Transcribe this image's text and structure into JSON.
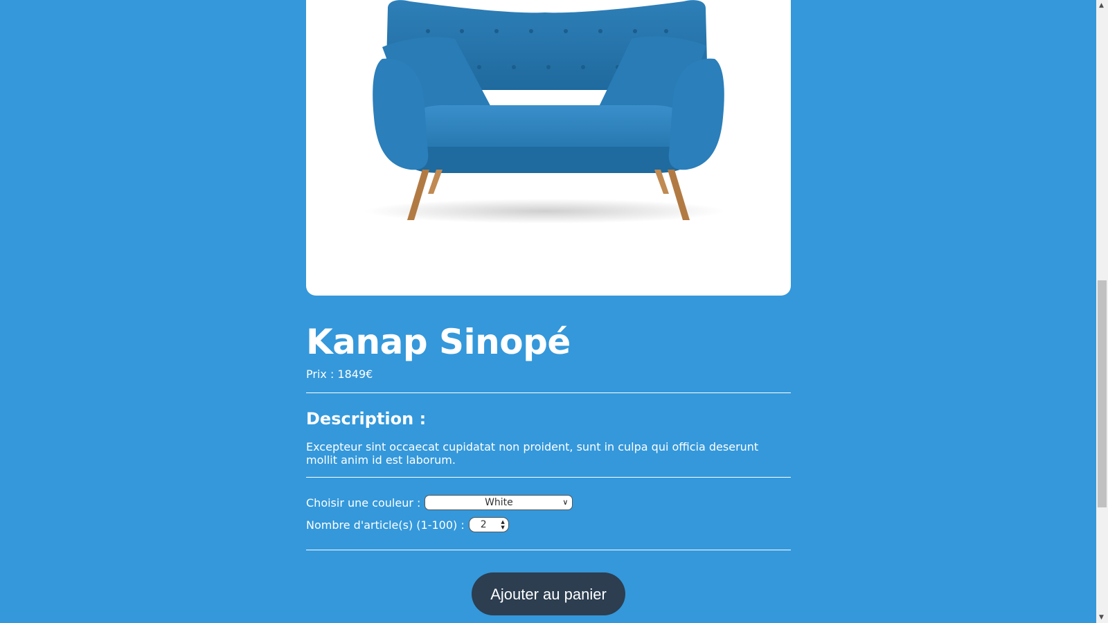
{
  "product": {
    "image_alt": "Kanap Sinopé",
    "name": "Kanap Sinopé",
    "price_label": "Prix : 1849€"
  },
  "description": {
    "title": "Description :",
    "text": "Excepteur sint occaecat cupidatat non proident, sunt in culpa qui officia deserunt mollit anim id est laborum."
  },
  "options": {
    "color_label": "Choisir une couleur :",
    "color_selected": "White",
    "quantity_label": "Nombre d'article(s) (1-100) :",
    "quantity_value": "2"
  },
  "actions": {
    "add_to_cart": "Ajouter au panier"
  },
  "colors": {
    "background": "#3498db",
    "button": "#2c3e50",
    "sofa": "#2f86c1"
  }
}
